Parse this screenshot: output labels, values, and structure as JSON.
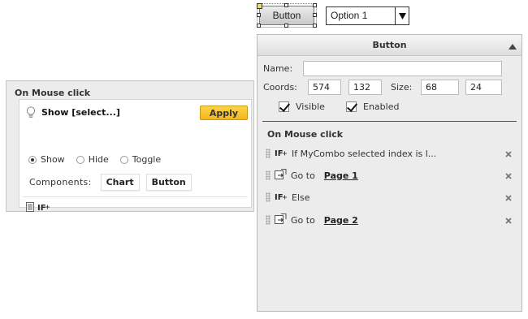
{
  "canvas": {
    "button_label": "Button",
    "combo_value": "Option 1"
  },
  "left_panel": {
    "header": "On Mouse click",
    "action_title": "Show [select...]",
    "apply_label": "Apply",
    "radios": [
      {
        "label": "Show",
        "checked": true
      },
      {
        "label": "Hide",
        "checked": false
      },
      {
        "label": "Toggle",
        "checked": false
      }
    ],
    "components_label": "Components:",
    "components": [
      "Chart",
      "Button"
    ]
  },
  "props_panel": {
    "title": "Button",
    "name_label": "Name:",
    "name_value": "",
    "coords_label": "Coords:",
    "x": "574",
    "y": "132",
    "size_label": "Size:",
    "width": "68",
    "height": "24",
    "visible_label": "Visible",
    "visible_checked": true,
    "enabled_label": "Enabled",
    "enabled_checked": true,
    "section_title": "On Mouse click",
    "actions": [
      {
        "icon": "if-icon",
        "text": "If MyCombo selected index is l...",
        "link": ""
      },
      {
        "icon": "goto-page-icon",
        "text": "Go to",
        "link": "Page 1"
      },
      {
        "icon": "if-icon",
        "text": "Else",
        "link": ""
      },
      {
        "icon": "goto-page-icon",
        "text": "Go to",
        "link": "Page 2"
      }
    ]
  }
}
